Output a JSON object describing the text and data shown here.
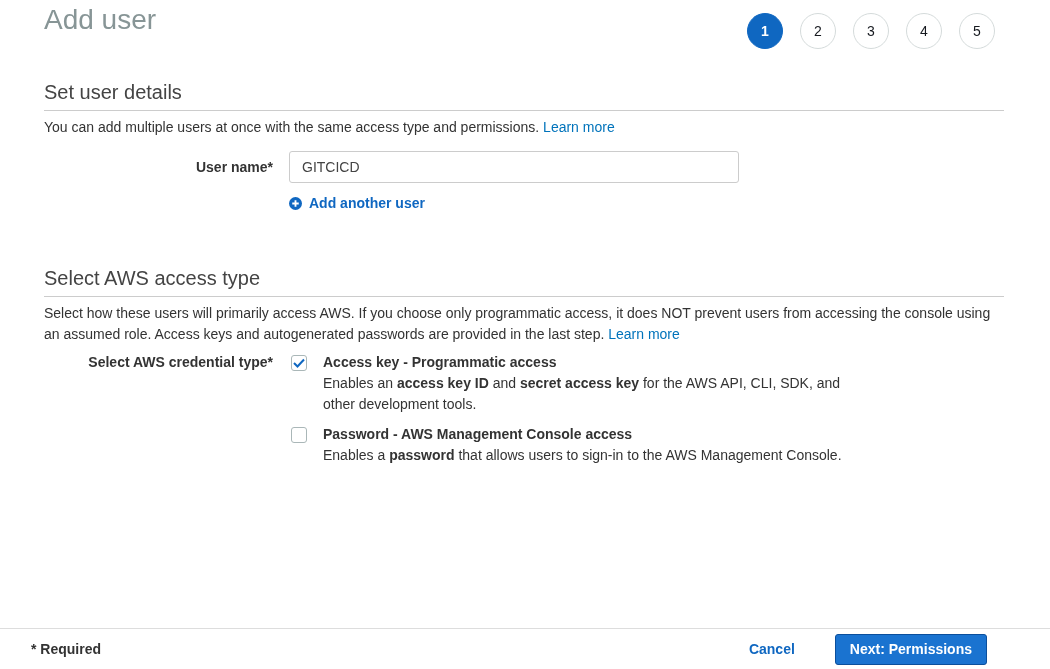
{
  "title": "Add user",
  "steps": [
    {
      "label": "1",
      "selected": true
    },
    {
      "label": "2",
      "selected": false
    },
    {
      "label": "3",
      "selected": false
    },
    {
      "label": "4",
      "selected": false
    },
    {
      "label": "5",
      "selected": false
    }
  ],
  "user_details": {
    "heading": "Set user details",
    "description": "You can add multiple users at once with the same access type and permissions.",
    "link": "Learn more",
    "field_label": "User name*",
    "field_value": "GITCICD",
    "add_link": "Add another user"
  },
  "access_type": {
    "heading": "Select AWS access type",
    "description": "Select how these users will primarily access AWS. If you choose only programmatic access, it does NOT prevent users from accessing the console using an assumed role. Access keys and autogenerated passwords are provided in the last step.",
    "link": "Learn more",
    "field_label": "Select AWS credential type*",
    "options": [
      {
        "title": "Access key - Programmatic access",
        "description": "Enables an **access key ID** and **secret access key** for the AWS API, CLI, SDK, and other development tools.",
        "checked": true
      },
      {
        "title": "Password - AWS Management Console access",
        "description": "Enables a **password** that allows users to sign-in to the AWS Management Console.",
        "checked": false
      }
    ]
  },
  "footer": {
    "note": "* Required",
    "cancel": "Cancel",
    "next": "Next: Permissions"
  }
}
